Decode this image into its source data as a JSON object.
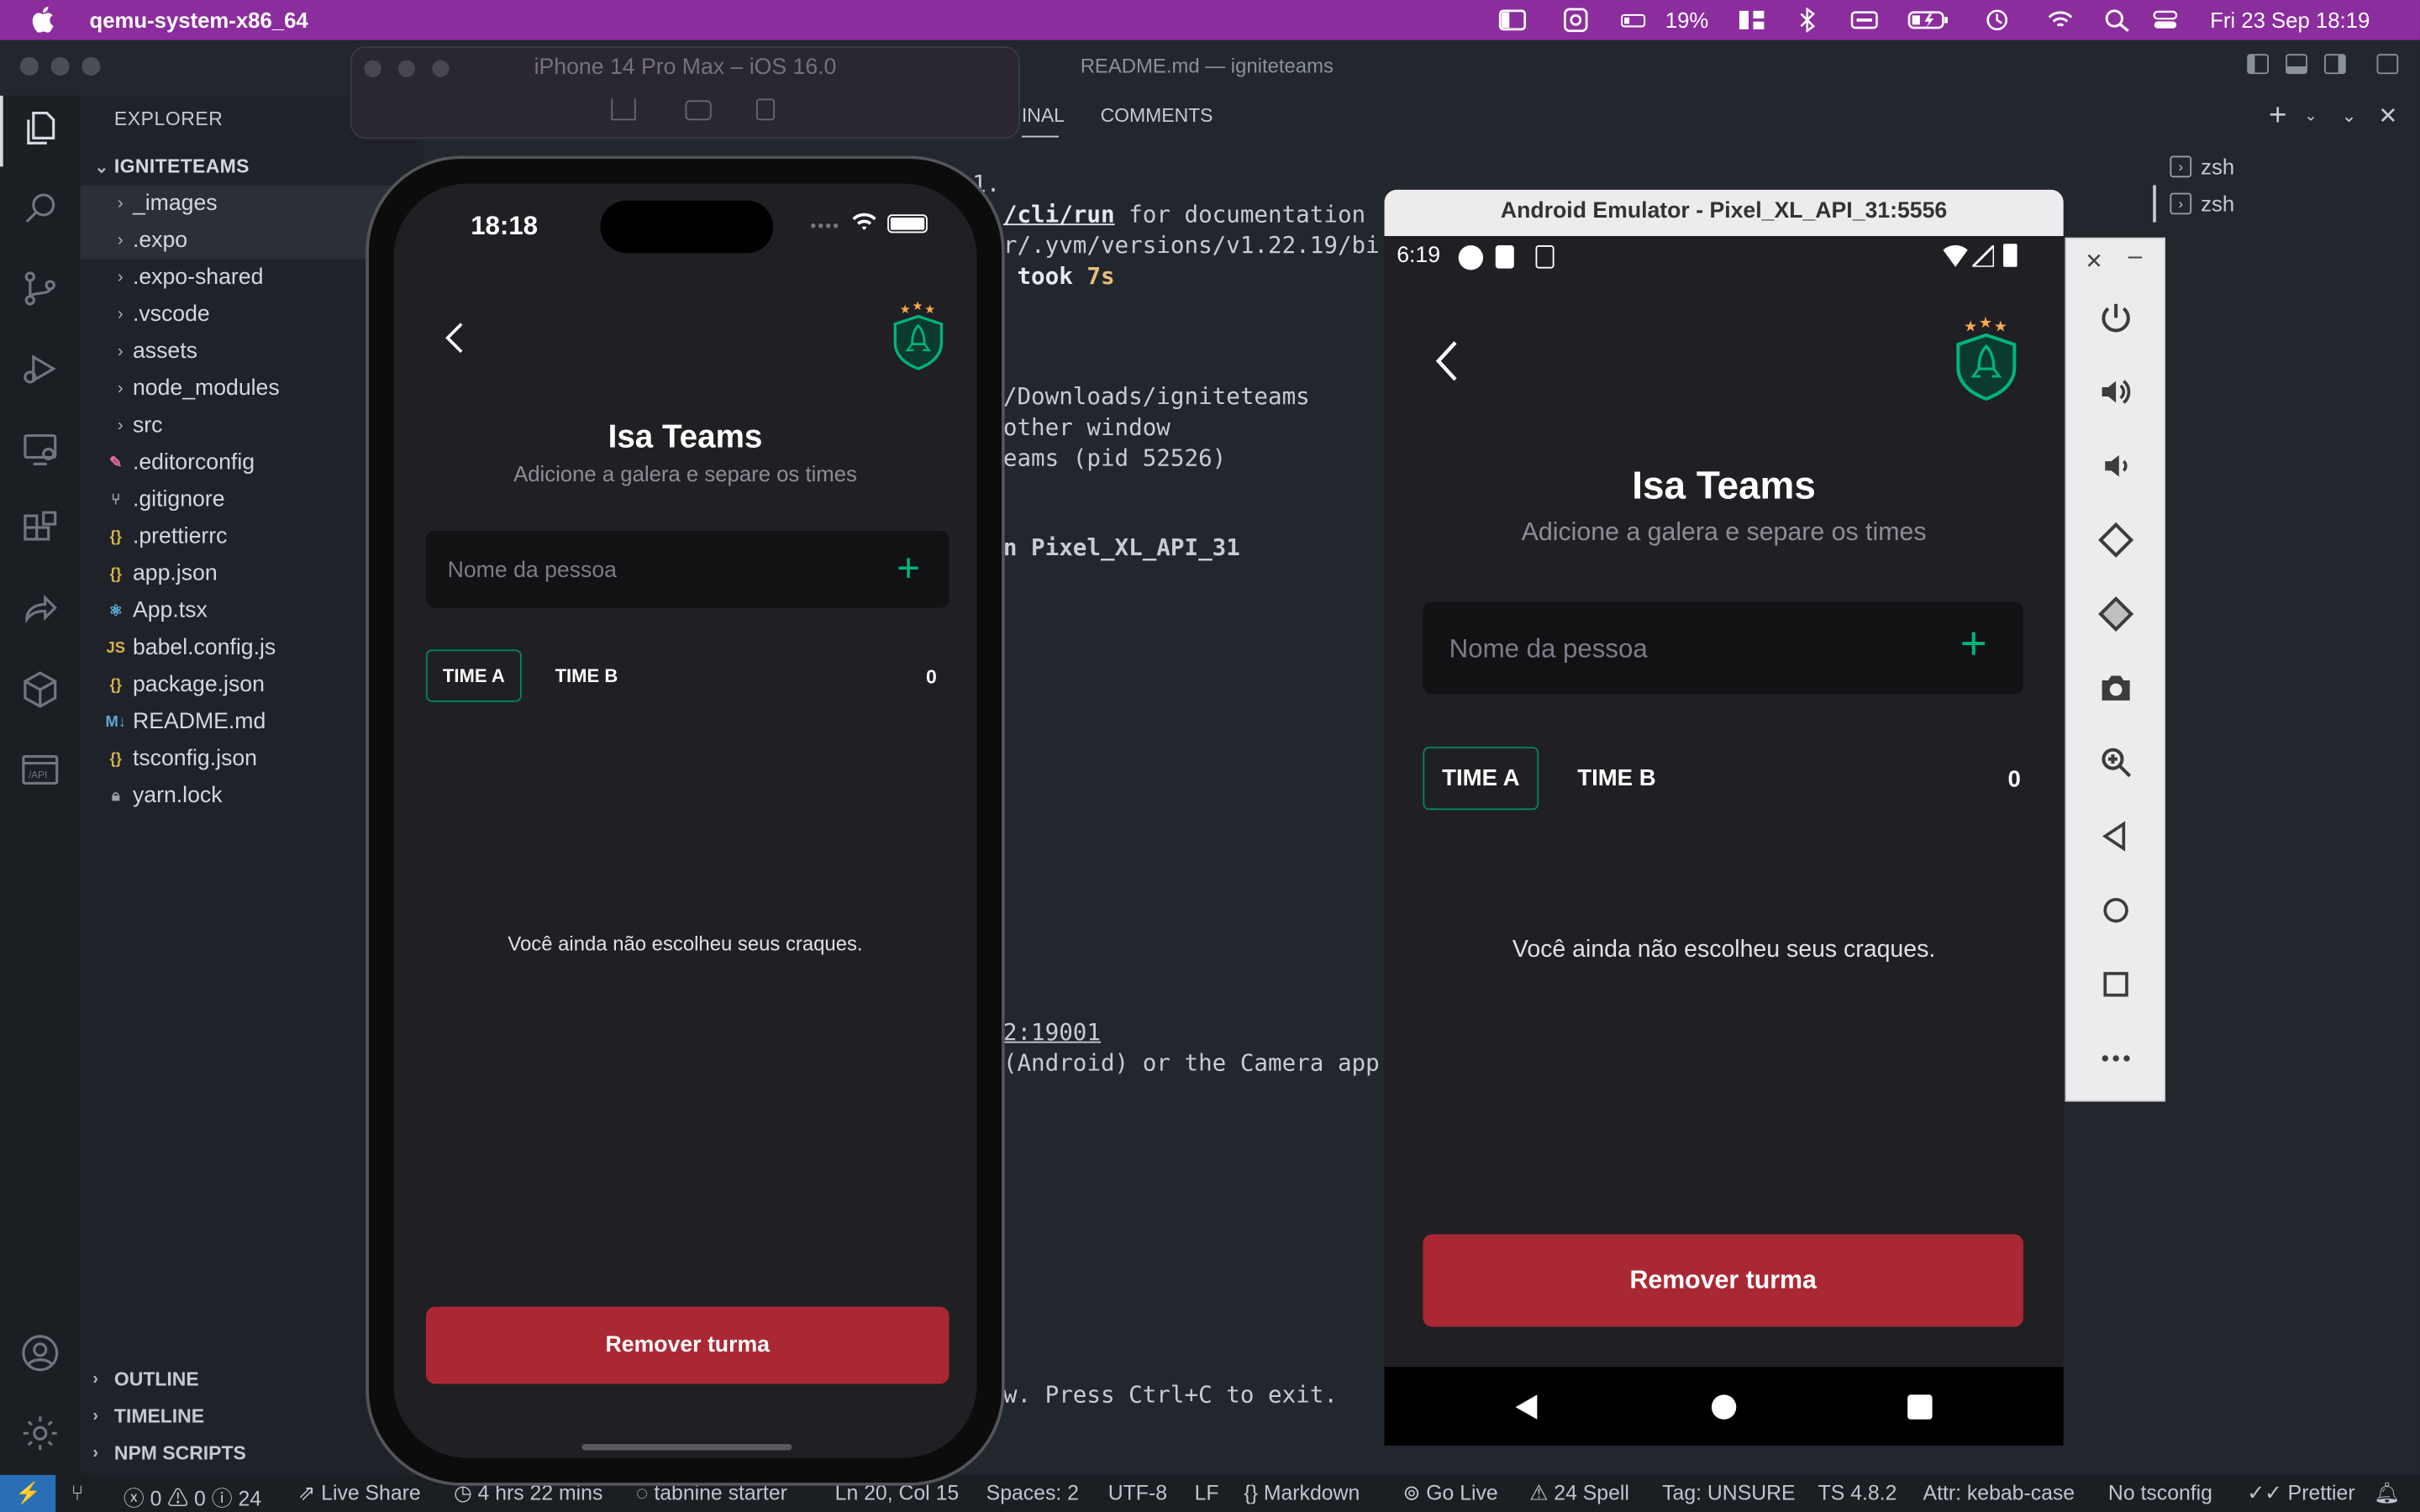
{
  "menubar": {
    "app_name": "qemu-system-x86_64",
    "battery": "19%",
    "datetime": "Fri 23 Sep  18:19"
  },
  "vscode": {
    "window_title": "README.md — igniteteams",
    "explorer_label": "EXPLORER",
    "panel_tab_terminal_fragment": "INAL",
    "panel_tab_comments": "COMMENTS",
    "root_folder": "IGNITETEAMS",
    "files": [
      {
        "name": "_images",
        "type": "folder"
      },
      {
        "name": ".expo",
        "type": "folder"
      },
      {
        "name": ".expo-shared",
        "type": "folder"
      },
      {
        "name": ".vscode",
        "type": "folder"
      },
      {
        "name": "assets",
        "type": "folder"
      },
      {
        "name": "node_modules",
        "type": "folder"
      },
      {
        "name": "src",
        "type": "folder"
      },
      {
        "name": ".editorconfig",
        "type": "editorconfig"
      },
      {
        "name": ".gitignore",
        "type": "git"
      },
      {
        "name": ".prettierrc",
        "type": "json"
      },
      {
        "name": "app.json",
        "type": "json"
      },
      {
        "name": "App.tsx",
        "type": "react"
      },
      {
        "name": "babel.config.js",
        "type": "js"
      },
      {
        "name": "package.json",
        "type": "json"
      },
      {
        "name": "README.md",
        "type": "md"
      },
      {
        "name": "tsconfig.json",
        "type": "json"
      },
      {
        "name": "yarn.lock",
        "type": "lock"
      }
    ],
    "sections": [
      "OUTLINE",
      "TIMELINE",
      "NPM SCRIPTS"
    ],
    "terminal_tabs": [
      "zsh",
      "zsh"
    ],
    "terminal_lines": {
      "l1": "1.",
      "l2a": "/cli/run",
      "l2b": " for documentation",
      "l3": "r/.yvm/versions/v1.22.19/bi",
      "l4a": " took ",
      "l4b": "7s",
      "l5": "/Downloads/igniteteams",
      "l6": "other window",
      "l7": "eams (pid 52526)",
      "l8": "n Pixel_XL_API_31",
      "l9": "2:19001",
      "l10": "(Android) or the Camera app",
      "l11": "w. Press Ctrl+C to exit."
    },
    "status": {
      "problems": "0",
      "warnings": "0",
      "infos": "24",
      "live_share": "Live Share",
      "time": "4 hrs 22 mins",
      "tabnine": "tabnine starter",
      "position": "Ln 20, Col 15",
      "spaces": "Spaces: 2",
      "encoding": "UTF-8",
      "eol": "LF",
      "language": "Markdown",
      "go_live": "Go Live",
      "spell": "24 Spell",
      "tag": "Tag: UNSURE",
      "ts": "TS 4.8.2",
      "attr": "Attr: kebab-case",
      "tsconfig": "No tsconfig",
      "prettier": "Prettier"
    }
  },
  "ios_sim": {
    "title": "iPhone 14 Pro Max – iOS 16.0",
    "clock": "18:18"
  },
  "android": {
    "window_title": "Android Emulator - Pixel_XL_API_31:5556",
    "clock": "6:19"
  },
  "app": {
    "title": "Isa Teams",
    "subtitle": "Adicione a galera e separe os times",
    "input_placeholder": "Nome da pessoa",
    "add_symbol": "+",
    "tab_a": "TIME A",
    "tab_b": "TIME B",
    "count": "0",
    "empty_message": "Você ainda não escolheu seus craques.",
    "remove_button": "Remover turma"
  },
  "colors": {
    "menubar": "#8c2d9e",
    "app_bg": "#202024",
    "accent_green": "#00b37e",
    "danger_red": "#aa2834"
  }
}
